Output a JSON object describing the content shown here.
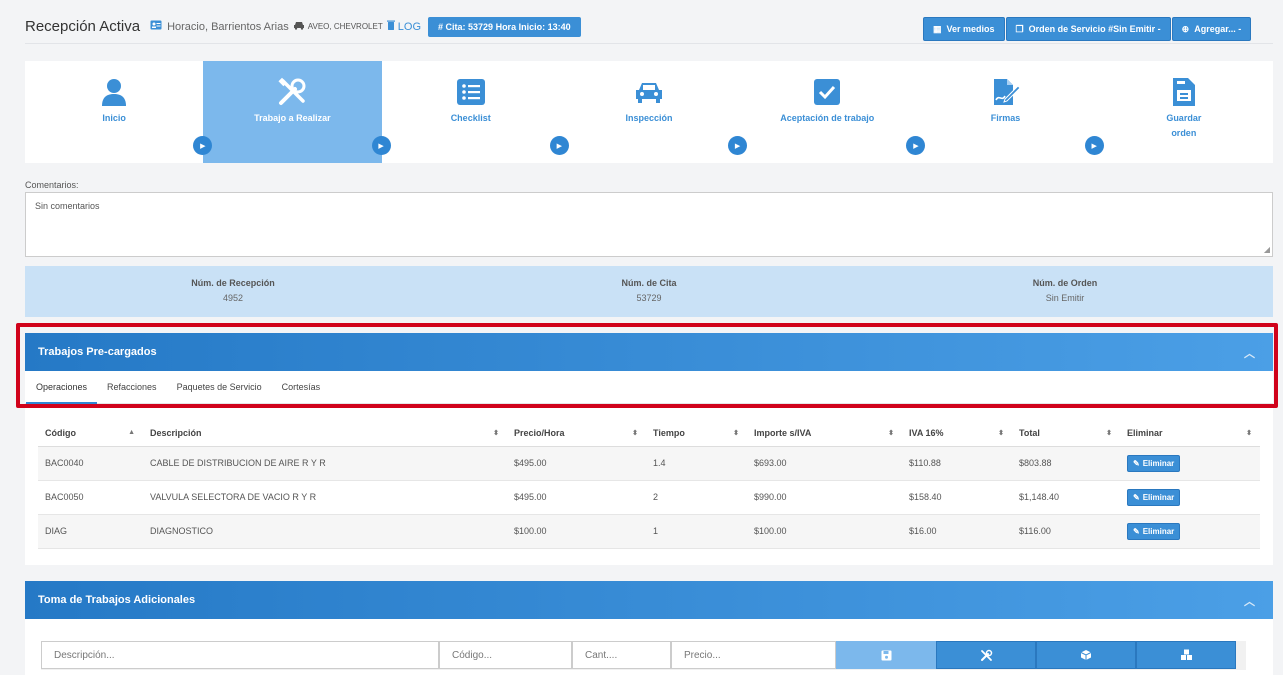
{
  "header": {
    "title": "Recepción Activa",
    "customer": "Horacio, Barrientos Arias",
    "vehicle_model": "AVEO, CHEVROLET",
    "log_label": "LOG",
    "cita_badge": "# Cita: 53729 Hora Inicio: 13:40",
    "buttons": {
      "ver_medios": "Ver medios",
      "orden_servicio": "Orden de Servicio #Sin Emitir -",
      "agregar": "Agregar... -"
    }
  },
  "wizard": {
    "steps": [
      {
        "label": "Inicio",
        "icon": "user-icon"
      },
      {
        "label": "Trabajo a Realizar",
        "icon": "tools-icon",
        "active": true
      },
      {
        "label": "Checklist",
        "icon": "list-icon"
      },
      {
        "label": "Inspección",
        "icon": "car-icon"
      },
      {
        "label": "Aceptación de trabajo",
        "icon": "check-square-icon"
      },
      {
        "label": "Firmas",
        "icon": "signature-icon"
      },
      {
        "label": "Guardar orden",
        "icon": "save-file-icon"
      }
    ]
  },
  "comments": {
    "label": "Comentarios:",
    "value": "Sin comentarios"
  },
  "numbers": {
    "recepcion_label": "Núm. de Recepción",
    "recepcion_value": "4952",
    "cita_label": "Núm. de Cita",
    "cita_value": "53729",
    "orden_label": "Núm. de Orden",
    "orden_value": "Sin Emitir"
  },
  "precargados": {
    "title": "Trabajos Pre-cargados",
    "tabs": [
      "Operaciones",
      "Refacciones",
      "Paquetes de Servicio",
      "Cortesías"
    ],
    "columns": [
      "Código",
      "Descripción",
      "Precio/Hora",
      "Tiempo",
      "Importe s/IVA",
      "IVA 16%",
      "Total",
      "Eliminar"
    ],
    "delete_label": "Eliminar",
    "rows": [
      {
        "codigo": "BAC0040",
        "descripcion": "CABLE DE DISTRIBUCION DE AIRE R Y R",
        "precio": "$495.00",
        "tiempo": "1.4",
        "importe": "$693.00",
        "iva": "$110.88",
        "total": "$803.88"
      },
      {
        "codigo": "BAC0050",
        "descripcion": "VALVULA SELECTORA DE VACIO R Y R",
        "precio": "$495.00",
        "tiempo": "2",
        "importe": "$990.00",
        "iva": "$158.40",
        "total": "$1,148.40"
      },
      {
        "codigo": "DIAG",
        "descripcion": "DIAGNOSTICO",
        "precio": "$100.00",
        "tiempo": "1",
        "importe": "$100.00",
        "iva": "$16.00",
        "total": "$116.00"
      }
    ]
  },
  "adicionales": {
    "title": "Toma de Trabajos Adicionales",
    "placeholders": {
      "descripcion": "Descripción...",
      "codigo": "Código...",
      "cantidad": "Cant....",
      "precio": "Precio..."
    }
  },
  "colors": {
    "accent": "#3b8fd6",
    "active_step": "#7cb8ec",
    "highlight": "#d0021b"
  }
}
